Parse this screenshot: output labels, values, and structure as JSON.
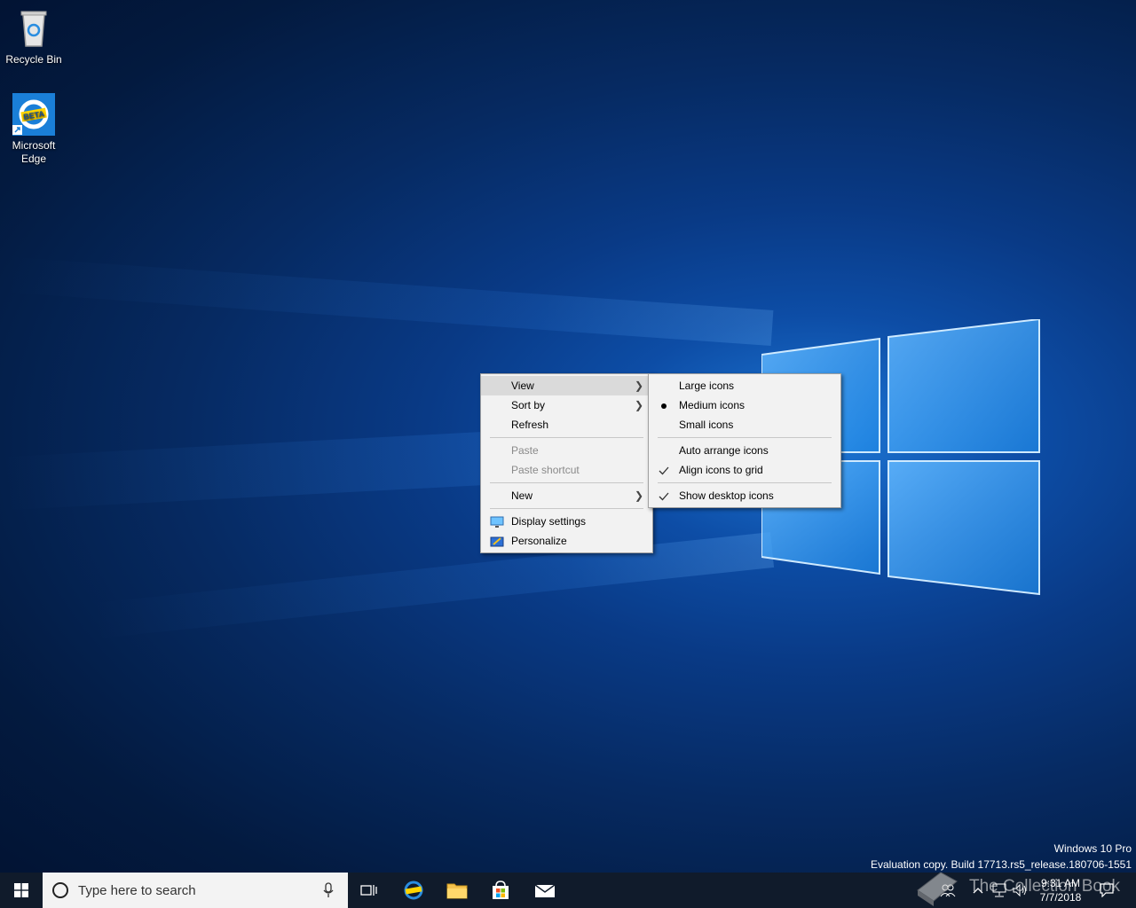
{
  "desktop": {
    "icons": [
      {
        "label": "Recycle Bin"
      },
      {
        "label_line1": "Microsoft",
        "label_line2": "Edge",
        "badge": "BETA"
      }
    ],
    "watermark": {
      "line1": "Windows 10 Pro",
      "line2": "Evaluation copy. Build 17713.rs5_release.180706-1551"
    },
    "overlay_text": "The Collection Book"
  },
  "context_menu": {
    "items": [
      {
        "label": "View",
        "submenu": true,
        "highlighted": true
      },
      {
        "label": "Sort by",
        "submenu": true
      },
      {
        "label": "Refresh"
      },
      {
        "label": "Paste",
        "disabled": true
      },
      {
        "label": "Paste shortcut",
        "disabled": true
      },
      {
        "label": "New",
        "submenu": true
      },
      {
        "label": "Display settings",
        "icon": "display-settings-icon"
      },
      {
        "label": "Personalize",
        "icon": "personalize-icon"
      }
    ]
  },
  "view_submenu": {
    "items": [
      {
        "label": "Large icons"
      },
      {
        "label": "Medium icons",
        "mark": "bullet"
      },
      {
        "label": "Small icons"
      },
      {
        "label": "Auto arrange icons"
      },
      {
        "label": "Align icons to grid",
        "mark": "check"
      },
      {
        "label": "Show desktop icons",
        "mark": "check"
      }
    ]
  },
  "taskbar": {
    "search_placeholder": "Type here to search",
    "pinned": [
      "task-view-icon",
      "edge-beta-icon",
      "file-explorer-icon",
      "store-icon",
      "mail-icon"
    ],
    "clock": {
      "time": "9:31 AM",
      "date": "7/7/2018"
    },
    "tray": [
      "people-icon",
      "chevron-up-icon",
      "network-icon",
      "volume-icon",
      "action-center-icon"
    ]
  },
  "colors": {
    "taskbar": "#101b2b",
    "menu_bg": "#f2f2f2",
    "menu_hover": "#dadada",
    "accent": "#0078d7"
  }
}
